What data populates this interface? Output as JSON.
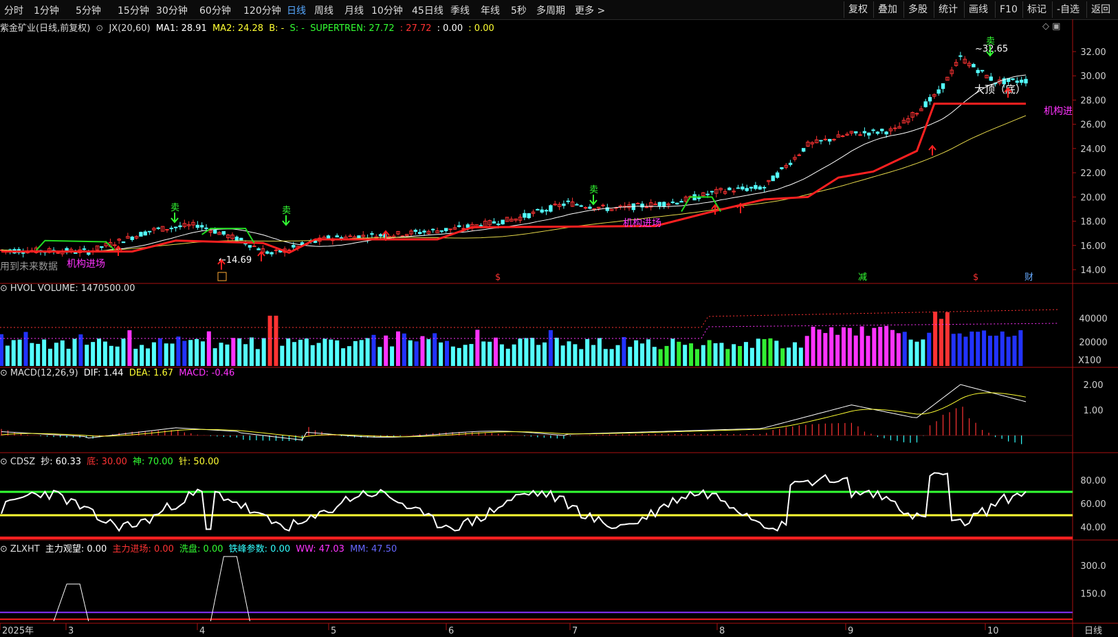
{
  "toolbar": {
    "tabs": [
      "分时",
      "1分钟",
      "5分钟",
      "15分钟",
      "30分钟",
      "60分钟",
      "120分钟",
      "日线",
      "周线",
      "月线",
      "10分钟",
      "45日线",
      "季线",
      "年线",
      "5秒",
      "多周期",
      "更多 >"
    ],
    "active_tab": "日线",
    "right_buttons": [
      "复权",
      "叠加",
      "多股",
      "统计",
      "画线",
      "F10",
      "标记",
      "-自选",
      "返回"
    ]
  },
  "main_legend": {
    "stock": "紫金矿业(日线,前复权)",
    "indicator": "JX(20,60)",
    "ma1": "MA1: 28.91",
    "ma2": "MA2: 24.28",
    "b": "B: -",
    "s": "S: -",
    "supertrend": "SUPERTREN: 27.72",
    "v1": ": 27.72",
    "v2": ": 0.00",
    "v3": ": 0.00"
  },
  "main_annotations": {
    "high": "32.65",
    "low": "14.69",
    "top_label": "大顶（底）",
    "inst_entry": "机构进场",
    "inst_entry_cut": "机构进",
    "future_data": "用到未来数据",
    "sell": "卖",
    "markers": [
      "$",
      "减",
      "$",
      "财"
    ]
  },
  "price_axis": [
    "32.00",
    "30.00",
    "28.00",
    "26.00",
    "24.00",
    "22.00",
    "20.00",
    "18.00",
    "16.00",
    "14.00"
  ],
  "volume": {
    "legend": "HVOL VOLUME: 1470500.00",
    "axis": [
      "40000",
      "20000"
    ],
    "unit": "X100"
  },
  "macd": {
    "name": "MACD(12,26,9)",
    "dif": "DIF: 1.44",
    "dea": "DEA: 1.67",
    "macd": "MACD: -0.46",
    "axis": [
      "2.00",
      "1.00"
    ]
  },
  "cdsz": {
    "name": "CDSZ",
    "chao": "抄: 60.33",
    "di": "底: 30.00",
    "shen": "神: 70.00",
    "zhen": "针: 50.00",
    "axis": [
      "80.00",
      "60.00",
      "40.00"
    ]
  },
  "zlxht": {
    "name": "ZLXHT",
    "wait": "主力观望: 0.00",
    "enter": "主力进场: 0.00",
    "wash": "洗盘: 0.00",
    "iron": "铁峰参数: 0.00",
    "ww": "WW: 47.03",
    "mm": "MM: 47.50",
    "axis": [
      "300.0",
      "150.0"
    ]
  },
  "time_axis": [
    "2025年",
    "3",
    "4",
    "5",
    "6",
    "7",
    "8",
    "9",
    "10"
  ],
  "period_label": "日线",
  "colors": {
    "up": "#ff3333",
    "down": "#54ffff",
    "ma1": "#ffffff",
    "ma2": "#e6d84a",
    "supertrend_up": "#ff2020",
    "supertrend_down": "#22dd22",
    "vol_magenta": "#ff33ff",
    "vol_blue": "#2233ff",
    "vol_green": "#33ee33"
  }
}
